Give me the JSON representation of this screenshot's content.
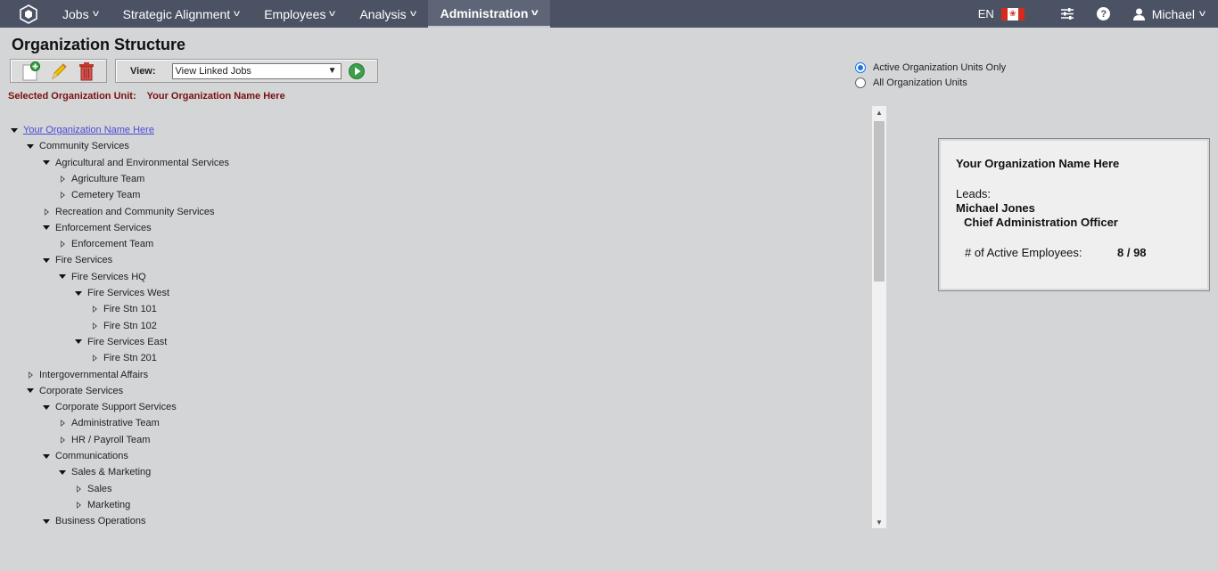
{
  "nav": {
    "items": [
      {
        "label": "Jobs"
      },
      {
        "label": "Strategic Alignment"
      },
      {
        "label": "Employees"
      },
      {
        "label": "Analysis"
      },
      {
        "label": "Administration",
        "active": true
      }
    ],
    "language": "EN",
    "user": "Michael",
    "help_symbol": "?"
  },
  "page": {
    "title": "Organization Structure",
    "view_label": "View:",
    "view_selected": "View Linked Jobs",
    "selected_label": "Selected Organization Unit:",
    "selected_value": "Your Organization Name Here"
  },
  "filters": {
    "options": [
      {
        "label": "Active Organization Units Only",
        "checked": true
      },
      {
        "label": "All Organization Units",
        "checked": false
      }
    ]
  },
  "tree": {
    "nodes": [
      {
        "label": "Your Organization Name Here",
        "level": 0,
        "expanded": true,
        "link": true
      },
      {
        "label": "Community Services",
        "level": 1,
        "expanded": true
      },
      {
        "label": "Agricultural and Environmental Services",
        "level": 2,
        "expanded": true
      },
      {
        "label": "Agriculture Team",
        "level": 3,
        "expanded": false
      },
      {
        "label": "Cemetery Team",
        "level": 3,
        "expanded": false
      },
      {
        "label": "Recreation and Community Services",
        "level": 2,
        "expanded": false
      },
      {
        "label": "Enforcement Services",
        "level": 2,
        "expanded": true
      },
      {
        "label": "Enforcement Team",
        "level": 3,
        "expanded": false
      },
      {
        "label": "Fire Services",
        "level": 2,
        "expanded": true
      },
      {
        "label": "Fire Services HQ",
        "level": 3,
        "expanded": true
      },
      {
        "label": "Fire Services West",
        "level": 4,
        "expanded": true
      },
      {
        "label": "Fire Stn 101",
        "level": 5,
        "expanded": false
      },
      {
        "label": "Fire Stn 102",
        "level": 5,
        "expanded": false
      },
      {
        "label": "Fire Services East",
        "level": 4,
        "expanded": true
      },
      {
        "label": "Fire Stn 201",
        "level": 5,
        "expanded": false
      },
      {
        "label": "Intergovernmental Affairs",
        "level": 1,
        "expanded": false
      },
      {
        "label": "Corporate Services",
        "level": 1,
        "expanded": true
      },
      {
        "label": "Corporate Support Services",
        "level": 2,
        "expanded": true
      },
      {
        "label": "Administrative Team",
        "level": 3,
        "expanded": false
      },
      {
        "label": "HR / Payroll Team",
        "level": 3,
        "expanded": false
      },
      {
        "label": "Communications",
        "level": 2,
        "expanded": true
      },
      {
        "label": "Sales & Marketing",
        "level": 3,
        "expanded": true
      },
      {
        "label": "Sales",
        "level": 4,
        "expanded": false
      },
      {
        "label": "Marketing",
        "level": 4,
        "expanded": false
      },
      {
        "label": "Business Operations",
        "level": 2,
        "expanded": true
      }
    ]
  },
  "info_panel": {
    "org_name": "Your Organization Name Here",
    "leads_label": "Leads:",
    "lead_name": "Michael Jones",
    "lead_title": "Chief Administration Officer",
    "employees_label": "# of Active Employees:",
    "employees_value": "8 / 98"
  },
  "colors": {
    "topbar": "#4a5263",
    "selected_text": "#7a1010",
    "link": "#4a4ad6",
    "radio_accent": "#1a73e8",
    "flag_red": "#d52b1e"
  }
}
